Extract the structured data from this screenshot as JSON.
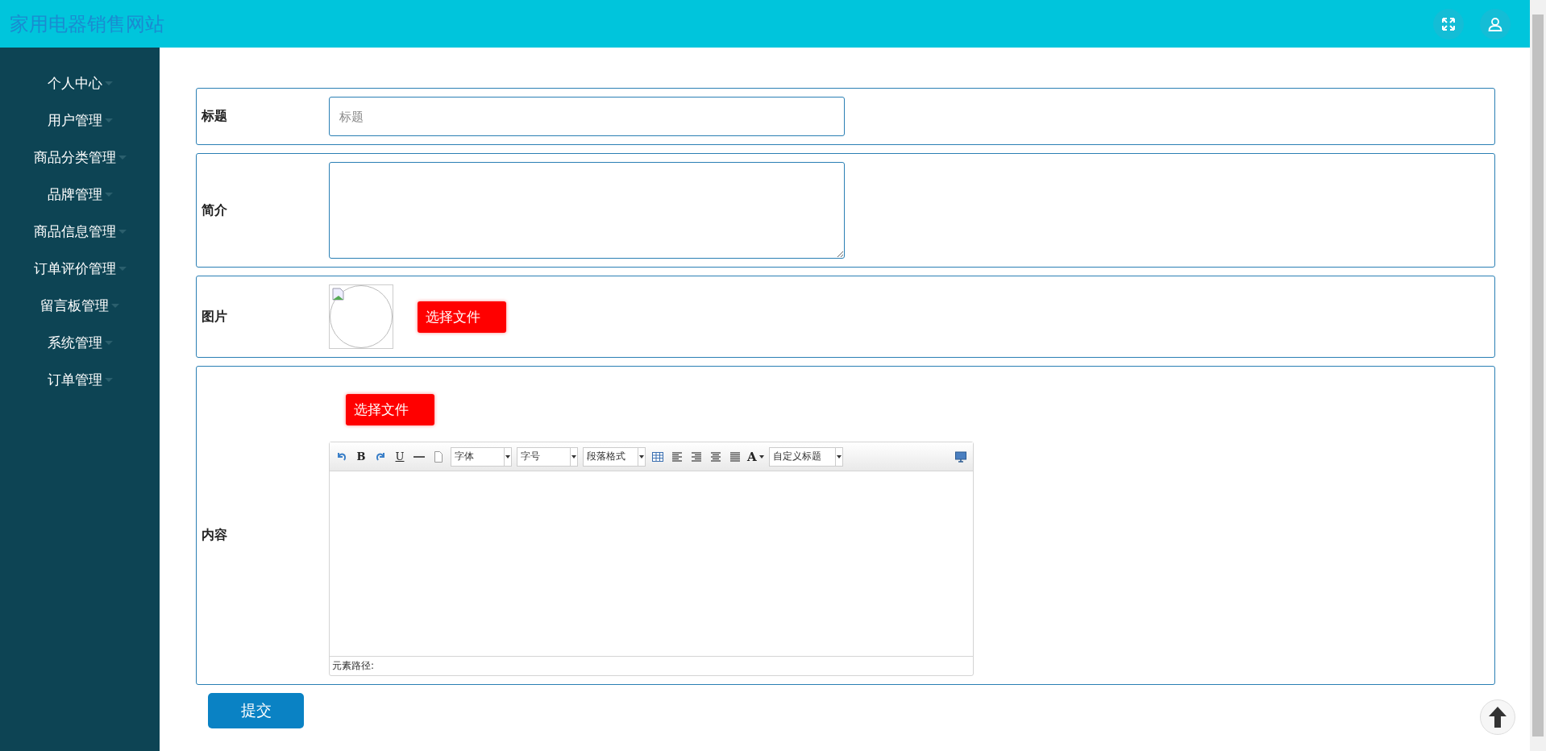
{
  "header": {
    "title": "家用电器销售网站"
  },
  "sidebar": {
    "items": [
      {
        "label": "个人中心"
      },
      {
        "label": "用户管理"
      },
      {
        "label": "商品分类管理"
      },
      {
        "label": "品牌管理"
      },
      {
        "label": "商品信息管理"
      },
      {
        "label": "订单评价管理"
      },
      {
        "label": "留言板管理"
      },
      {
        "label": "系统管理"
      },
      {
        "label": "订单管理"
      }
    ]
  },
  "form": {
    "rows": [
      {
        "kind": "input",
        "label": "标题",
        "placeholder": "标题"
      },
      {
        "kind": "textarea",
        "label": "简介"
      },
      {
        "kind": "image",
        "label": "图片",
        "button": "选择文件"
      },
      {
        "kind": "editor",
        "label": "内容",
        "button": "选择文件"
      }
    ],
    "editor": {
      "toolbar": {
        "bold": "B",
        "underline": "U",
        "font_family": "字体",
        "font_size": "字号",
        "paragraph": "段落格式",
        "font_color": "A",
        "custom_title": "自定义标题"
      },
      "status": "元素路径:"
    },
    "submit": "提交"
  }
}
